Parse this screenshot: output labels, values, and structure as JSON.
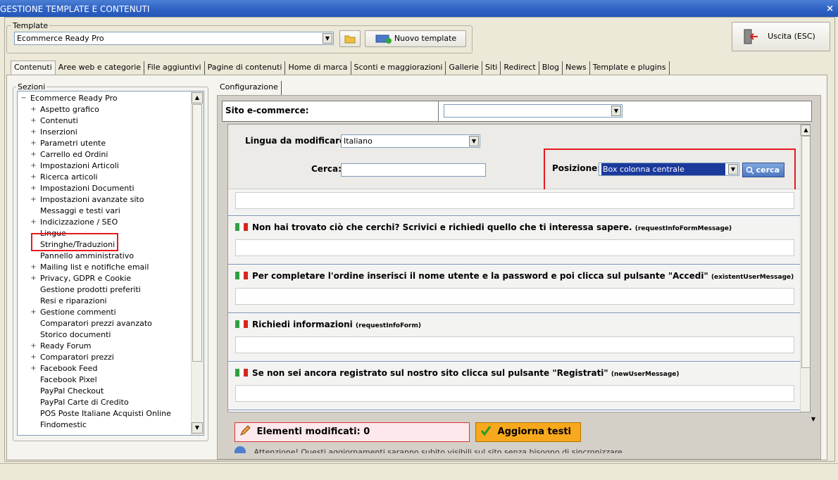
{
  "window": {
    "title": "GESTIONE TEMPLATE E CONTENUTI",
    "close": "×"
  },
  "template": {
    "legend": "Template",
    "selected": "Ecommerce Ready Pro",
    "new_label": "Nuovo template"
  },
  "exit_label": "Uscita (ESC)",
  "tabs": [
    "Contenuti",
    "Aree web e categorie",
    "File aggiuntivi",
    "Pagine di contenuti",
    "Home di marca",
    "Sconti e maggiorazioni",
    "Gallerie",
    "Siti",
    "Redirect",
    "Blog",
    "News",
    "Template e plugins"
  ],
  "sections": {
    "legend": "Sezioni",
    "root": "Ecommerce Ready Pro",
    "items": [
      {
        "label": "Aspetto grafico",
        "expand": "+"
      },
      {
        "label": "Contenuti",
        "expand": "+"
      },
      {
        "label": "Inserzioni",
        "expand": "+"
      },
      {
        "label": "Parametri utente",
        "expand": "+"
      },
      {
        "label": "Carrello ed Ordini",
        "expand": "+"
      },
      {
        "label": "Impostazioni Articoli",
        "expand": "+"
      },
      {
        "label": "Ricerca articoli",
        "expand": "+"
      },
      {
        "label": "Impostazioni Documenti",
        "expand": "+"
      },
      {
        "label": "Impostazioni avanzate sito",
        "expand": "+"
      },
      {
        "label": "Messaggi e testi vari",
        "expand": ""
      },
      {
        "label": "Indicizzazione / SEO",
        "expand": "+"
      },
      {
        "label": "Lingue",
        "expand": ""
      },
      {
        "label": "Stringhe/Traduzioni",
        "expand": ""
      },
      {
        "label": "Pannello amministrativo",
        "expand": ""
      },
      {
        "label": "Mailing list e notifiche email",
        "expand": "+"
      },
      {
        "label": "Privacy, GDPR e Cookie",
        "expand": "+"
      },
      {
        "label": "Gestione prodotti preferiti",
        "expand": ""
      },
      {
        "label": "Resi e riparazioni",
        "expand": ""
      },
      {
        "label": "Gestione commenti",
        "expand": "+"
      },
      {
        "label": "Comparatori prezzi avanzato",
        "expand": ""
      },
      {
        "label": "Storico documenti",
        "expand": ""
      },
      {
        "label": "Ready Forum",
        "expand": "+"
      },
      {
        "label": "Comparatori prezzi",
        "expand": "+"
      },
      {
        "label": "Facebook Feed",
        "expand": "+"
      },
      {
        "label": "Facebook Pixel",
        "expand": ""
      },
      {
        "label": "PayPal Checkout",
        "expand": ""
      },
      {
        "label": "PayPal Carte di Credito",
        "expand": ""
      },
      {
        "label": "POS Poste Italiane Acquisti Online",
        "expand": ""
      },
      {
        "label": "Findomestic",
        "expand": ""
      }
    ]
  },
  "config": {
    "tab": "Configurazione",
    "sito_label": "Sito e-commerce:",
    "sito_value": "",
    "lingua_label": "Lingua da modificare:",
    "lingua_value": "Italiano",
    "cerca_label": "Cerca:",
    "cerca_value": "",
    "posizione_label": "Posizione:",
    "posizione_value": "Box colonna centrale",
    "cerca_button": "cerca",
    "entries": [
      {
        "text": "Non hai trovato ciò che cerchi? Scrivici e richiedi quello che ti interessa sapere.",
        "key": "(requestInfoFormMessage)"
      },
      {
        "text": "Per completare l'ordine inserisci il nome utente e la password e poi clicca sul pulsante \"Accedi\"",
        "key": "(existentUserMessage)"
      },
      {
        "text": "Richiedi informazioni",
        "key": "(requestInfoForm)"
      },
      {
        "text": "Se non sei ancora registrato sul nostro sito clicca sul pulsante \"Registrati\"",
        "key": "(newUserMessage)"
      }
    ],
    "modified_label": "Elementi modificati: 0",
    "update_label": "Aggiorna testi",
    "notice": "Attenzione! Questi aggiornamenti saranno subito visibili sul sito senza bisogno di sincronizzare"
  }
}
